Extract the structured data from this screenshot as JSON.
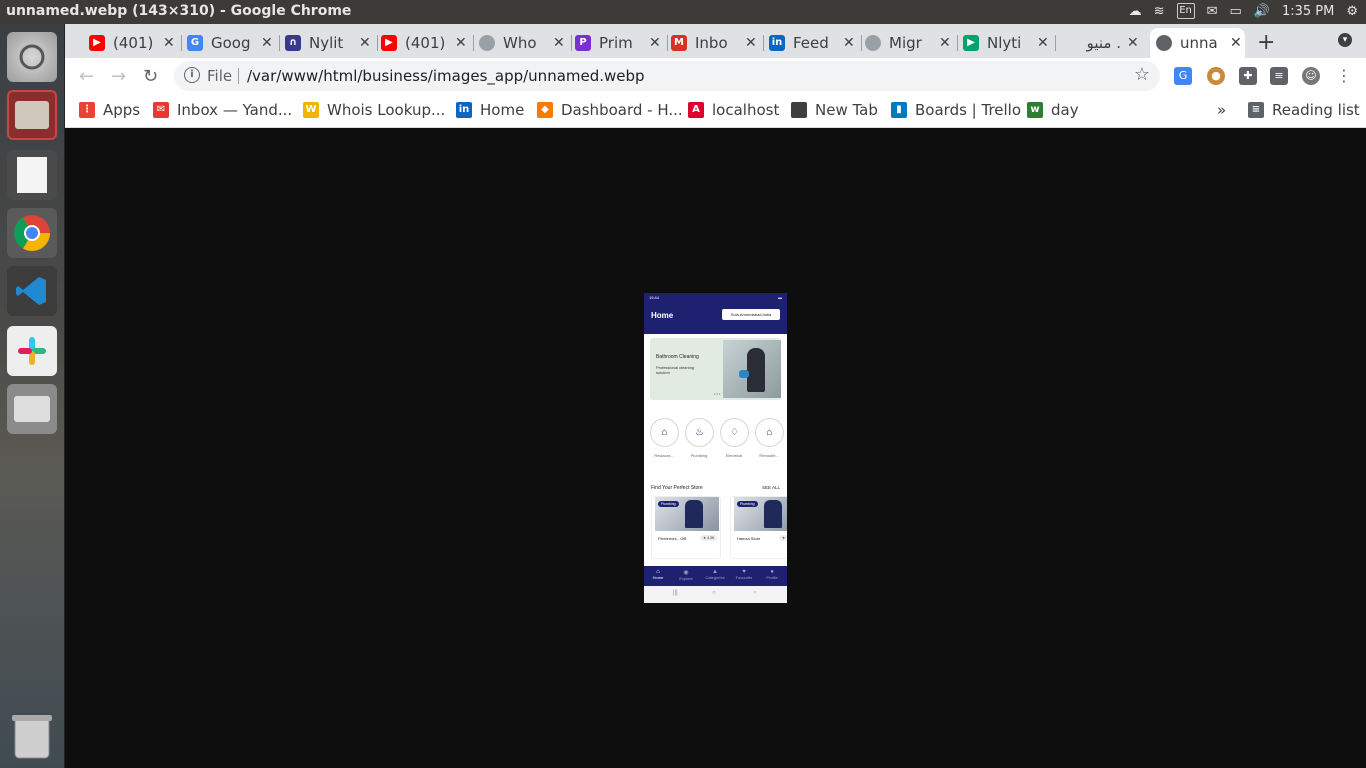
{
  "window": {
    "title": "unnamed.webp (143×310) - Google Chrome"
  },
  "system": {
    "lang": "En",
    "time": "1:35 PM"
  },
  "tabs": [
    {
      "title": "(401)",
      "color": "#ff0000",
      "icon": "youtube-icon"
    },
    {
      "title": "Goog",
      "color": "#4285f4",
      "icon": "google-translate-icon"
    },
    {
      "title": "Nylit",
      "color": "#3a3a8c",
      "icon": "nylit-icon"
    },
    {
      "title": "(401)",
      "color": "#ff0000",
      "icon": "youtube-icon"
    },
    {
      "title": "Who",
      "color": "#9aa0a6",
      "icon": "globe-icon"
    },
    {
      "title": "Prim",
      "color": "#7b2fd3",
      "icon": "prime-icon"
    },
    {
      "title": "Inbo",
      "color": "#d93025",
      "icon": "gmail-icon"
    },
    {
      "title": "Feed",
      "color": "#0a66c2",
      "icon": "linkedin-icon"
    },
    {
      "title": "Migr",
      "color": "#9aa0a6",
      "icon": "globe-icon"
    },
    {
      "title": "Nlyti",
      "color": "#00a36c",
      "icon": "play-store-icon"
    },
    {
      "title": "منيو .",
      "color": "#e53935",
      "icon": "dot-icon"
    },
    {
      "title": "unna",
      "color": "#5f6368",
      "icon": "globe-icon",
      "active": true
    }
  ],
  "toolbar": {
    "scheme": "File",
    "url": "/var/www/html/business/images_app/unnamed.webp"
  },
  "bookmarks": [
    {
      "label": "Apps",
      "color": "#ea4335",
      "icon": "apps-grid-icon"
    },
    {
      "label": "Inbox — Yand...",
      "color": "#e53935",
      "icon": "yandex-mail-icon"
    },
    {
      "label": "Whois Lookup...",
      "color": "#f1b500",
      "icon": "whois-icon"
    },
    {
      "label": "Home",
      "color": "#0a66c2",
      "icon": "linkedin-icon"
    },
    {
      "label": "Dashboard - H...",
      "color": "#f57c00",
      "icon": "dashboard-icon"
    },
    {
      "label": "localhost",
      "color": "#dd0031",
      "icon": "angular-icon"
    },
    {
      "label": "New Tab",
      "color": "#3c4043",
      "icon": "new-tab-icon"
    },
    {
      "label": "Boards | Trello",
      "color": "#0079bf",
      "icon": "trello-icon"
    },
    {
      "label": "day",
      "color": "#2e7d32",
      "icon": "day-icon"
    }
  ],
  "reading_list": "Reading list",
  "phone": {
    "status_time": "19:44",
    "header_title": "Home",
    "location": "Sola,Ahmedabad,India",
    "banner": {
      "title": "Bathroom Cleaning",
      "subtitle": "Professional cleaning solution"
    },
    "categories": [
      {
        "label": "Restaura...",
        "icon": "restaurant-icon"
      },
      {
        "label": "Plumbing",
        "icon": "faucet-icon"
      },
      {
        "label": "Electrical",
        "icon": "bulb-icon"
      },
      {
        "label": "Remodel...",
        "icon": "house-icon"
      }
    ],
    "section_title": "Find Your Perfect Store",
    "see_all": "SEE ALL",
    "stores": [
      {
        "tag": "Plumbing",
        "name": "Flexterlors - Offi",
        "rating": "★ 4.36"
      },
      {
        "tag": "Plumbing",
        "name": "Hamza Store",
        "rating": "★"
      }
    ],
    "nav": [
      {
        "label": "Home",
        "icon": "home-icon",
        "active": true
      },
      {
        "label": "Explore",
        "icon": "explore-icon"
      },
      {
        "label": "Categories",
        "icon": "categories-icon"
      },
      {
        "label": "Favourite",
        "icon": "heart-icon"
      },
      {
        "label": "Profile",
        "icon": "profile-icon"
      }
    ]
  }
}
